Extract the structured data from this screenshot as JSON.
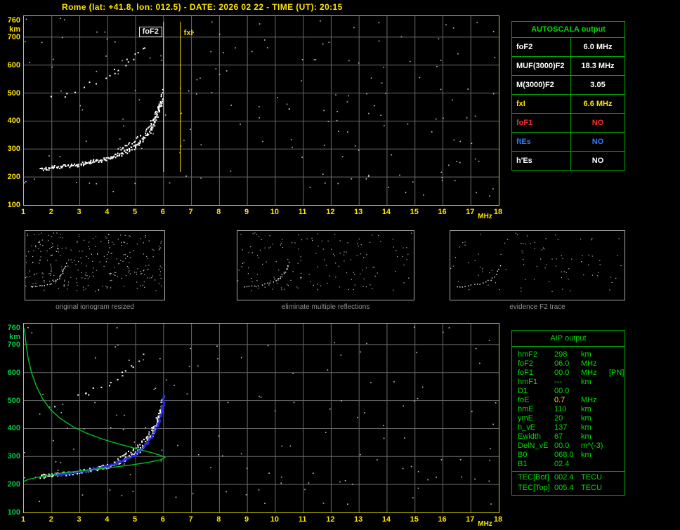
{
  "title": "Rome (lat: +41.8, lon: 012.5) - DATE: 2026 02 22 - TIME (UT): 20:15",
  "autoscala": {
    "header": "AUTOSCALA output",
    "rows": [
      {
        "label": "foF2",
        "value": "6.0 MHz",
        "color": "#ffffff"
      },
      {
        "label": "MUF(3000)F2",
        "value": "18.3 MHz",
        "color": "#ffffff"
      },
      {
        "label": "M(3000)F2",
        "value": "3.05",
        "color": "#ffffff"
      },
      {
        "label": "fxI",
        "value": "6.6 MHz",
        "color": "#ffe400"
      },
      {
        "label": "foF1",
        "value": "NO",
        "color": "#ff2a2a"
      },
      {
        "label": "ftEs",
        "value": "NO",
        "color": "#2d7dff"
      },
      {
        "label": "h'Es",
        "value": "NO",
        "color": "#ffffff"
      }
    ]
  },
  "aip": {
    "header": "AIP output",
    "rows": [
      {
        "label": "hmF2",
        "value": "298",
        "unit": "km",
        "note": ""
      },
      {
        "label": "foF2",
        "value": "06.0",
        "unit": "MHz",
        "note": ""
      },
      {
        "label": "foF1",
        "value": "00.0",
        "unit": "MHz",
        "note": "[PN]"
      },
      {
        "label": "hmF1",
        "value": "---",
        "unit": "km",
        "note": ""
      },
      {
        "label": "D1",
        "value": "00.0",
        "unit": "",
        "note": ""
      },
      {
        "label": "foE",
        "value": "0.7",
        "unit": "MHz",
        "note": "",
        "value_color": "#ffe400"
      },
      {
        "label": "hmE",
        "value": "110",
        "unit": "km",
        "note": ""
      },
      {
        "label": "ymE",
        "value": "20",
        "unit": "km",
        "note": ""
      },
      {
        "label": "h_vE",
        "value": "137",
        "unit": "km",
        "note": ""
      },
      {
        "label": "Ewidth",
        "value": "67",
        "unit": "km",
        "note": ""
      },
      {
        "label": "DelN_vE",
        "value": "00.0",
        "unit": "m^(-3)",
        "note": ""
      },
      {
        "label": "B0",
        "value": "068.0",
        "unit": "km",
        "note": ""
      },
      {
        "label": "B1",
        "value": "02.4",
        "unit": "",
        "note": ""
      },
      {
        "label": "TEC[Bot]",
        "value": "002.4",
        "unit": "TECU",
        "note": "",
        "sep": true
      },
      {
        "label": "TEC[Top]",
        "value": "005.4",
        "unit": "TECU",
        "note": ""
      }
    ]
  },
  "chart_data": [
    {
      "name": "main_ionogram",
      "type": "scatter",
      "xlabel": "MHz",
      "ylabel": "km",
      "xlim": [
        1,
        18
      ],
      "ylim": [
        100,
        760
      ],
      "x_ticks": [
        1,
        2,
        3,
        4,
        5,
        6,
        7,
        8,
        9,
        10,
        11,
        12,
        13,
        14,
        15,
        16,
        17,
        18
      ],
      "y_ticks": [
        760,
        700,
        600,
        500,
        400,
        300,
        200,
        100
      ],
      "grid": true,
      "noise": 170,
      "series": [
        {
          "name": "F2-trace-ordinary",
          "color": "#ffffff",
          "mode": "scatter",
          "size": 2,
          "step": 2.2,
          "jitter": 1.8,
          "rows": 2,
          "density": 1,
          "points": [
            [
              1.6,
              234
            ],
            [
              1.85,
              236
            ],
            [
              2.1,
              239
            ],
            [
              2.4,
              242
            ],
            [
              2.7,
              246
            ],
            [
              3.0,
              250
            ],
            [
              3.3,
              256
            ],
            [
              3.6,
              262
            ],
            [
              3.9,
              268
            ],
            [
              4.15,
              276
            ],
            [
              4.4,
              285
            ],
            [
              4.65,
              296
            ],
            [
              4.9,
              310
            ],
            [
              5.1,
              325
            ],
            [
              5.3,
              345
            ],
            [
              5.48,
              368
            ],
            [
              5.62,
              394
            ],
            [
              5.74,
              422
            ],
            [
              5.84,
              452
            ],
            [
              5.92,
              480
            ]
          ]
        },
        {
          "name": "F2-trace-extraordinary",
          "color": "#ffffff",
          "mode": "scatter",
          "size": 2,
          "step": 2.8,
          "jitter": 1.8,
          "rows": 1,
          "density": 0.9,
          "points": [
            [
              4.35,
              298
            ],
            [
              4.6,
              310
            ],
            [
              4.85,
              324
            ],
            [
              5.08,
              342
            ],
            [
              5.3,
              363
            ],
            [
              5.5,
              389
            ],
            [
              5.66,
              418
            ],
            [
              5.8,
              450
            ],
            [
              5.9,
              484
            ],
            [
              5.98,
              518
            ]
          ]
        },
        {
          "name": "second-hop-echo",
          "color": "#ffffff",
          "mode": "scatter",
          "size": 2,
          "step": 3.5,
          "jitter": 3.5,
          "rows": 1,
          "density": 0.55,
          "points": [
            [
              2.0,
              482
            ],
            [
              2.35,
              492
            ],
            [
              2.7,
              504
            ],
            [
              3.05,
              518
            ],
            [
              3.4,
              534
            ],
            [
              3.75,
              552
            ],
            [
              4.1,
              572
            ],
            [
              4.45,
              594
            ],
            [
              4.75,
              618
            ],
            [
              5.05,
              643
            ],
            [
              5.3,
              668
            ]
          ]
        }
      ],
      "annotations": [
        {
          "label": "foF2",
          "freq": 6.0,
          "color": "#e8e8e8"
        },
        {
          "label": "fxI",
          "freq": 6.6,
          "color": "#ffe400"
        }
      ]
    },
    {
      "name": "restored_ionogram",
      "type": "scatter",
      "xlabel": "MHz",
      "ylabel": "km",
      "xlim": [
        1,
        18
      ],
      "ylim": [
        100,
        760
      ],
      "x_ticks": [
        1,
        2,
        3,
        4,
        5,
        6,
        7,
        8,
        9,
        10,
        11,
        12,
        13,
        14,
        15,
        16,
        17,
        18
      ],
      "y_ticks": [
        760,
        700,
        600,
        500,
        400,
        300,
        200,
        100
      ],
      "grid": true,
      "noise": 130,
      "series_ref": "main_ionogram",
      "series": [
        {
          "name": "autoscaled-F2-trace",
          "color": "#2b2be6",
          "mode": "scatter",
          "size": 3,
          "step": 2.2,
          "jitter": 1.4,
          "rows": 1,
          "density": 1,
          "points": [
            [
              2.05,
              237
            ],
            [
              2.4,
              242
            ],
            [
              2.75,
              246
            ],
            [
              3.1,
              251
            ],
            [
              3.45,
              258
            ],
            [
              3.8,
              266
            ],
            [
              4.1,
              274
            ],
            [
              4.4,
              284
            ],
            [
              4.7,
              297
            ],
            [
              4.95,
              312
            ],
            [
              5.18,
              330
            ],
            [
              5.38,
              350
            ],
            [
              5.55,
              374
            ],
            [
              5.68,
              400
            ],
            [
              5.8,
              430
            ],
            [
              5.89,
              462
            ],
            [
              5.96,
              495
            ],
            [
              6.0,
              525
            ]
          ]
        },
        {
          "name": "electron-density-profile",
          "color": "#00c41e",
          "mode": "line",
          "width": 1.4,
          "points": [
            [
              1.02,
              758
            ],
            [
              1.07,
              706
            ],
            [
              1.15,
              652
            ],
            [
              1.28,
              598
            ],
            [
              1.46,
              548
            ],
            [
              1.68,
              505
            ],
            [
              1.95,
              468
            ],
            [
              2.3,
              436
            ],
            [
              2.75,
              407
            ],
            [
              3.25,
              383
            ],
            [
              3.85,
              361
            ],
            [
              4.5,
              342
            ],
            [
              5.1,
              326
            ],
            [
              5.6,
              313
            ],
            [
              5.92,
              303
            ],
            [
              6.05,
              297
            ],
            [
              5.92,
              289
            ],
            [
              5.5,
              280
            ],
            [
              4.85,
              270
            ],
            [
              4.05,
              260
            ],
            [
              3.15,
              250
            ],
            [
              2.3,
              240
            ],
            [
              1.6,
              228
            ],
            [
              1.15,
              218
            ],
            [
              1.0,
              211
            ]
          ]
        }
      ]
    },
    {
      "name": "thumb_original",
      "type": "scatter",
      "caption": "original ionogram resized",
      "xlim": [
        1,
        18
      ],
      "ylim": [
        100,
        760
      ],
      "series_ref": "main_ionogram",
      "noise": 260
    },
    {
      "name": "thumb_filtered",
      "type": "scatter",
      "caption": "eliminate multiple reflections",
      "xlim": [
        1,
        18
      ],
      "ylim": [
        100,
        760
      ],
      "series_ref": "main_ionogram",
      "exclude": [
        "second-hop-echo"
      ],
      "noise": 150
    },
    {
      "name": "thumb_f2",
      "type": "scatter",
      "caption": "evidence F2 trace",
      "xlim": [
        1,
        18
      ],
      "ylim": [
        100,
        760
      ],
      "series_ref": "main_ionogram",
      "exclude": [
        "second-hop-echo",
        "F2-trace-extraordinary"
      ],
      "noise": 90
    }
  ]
}
